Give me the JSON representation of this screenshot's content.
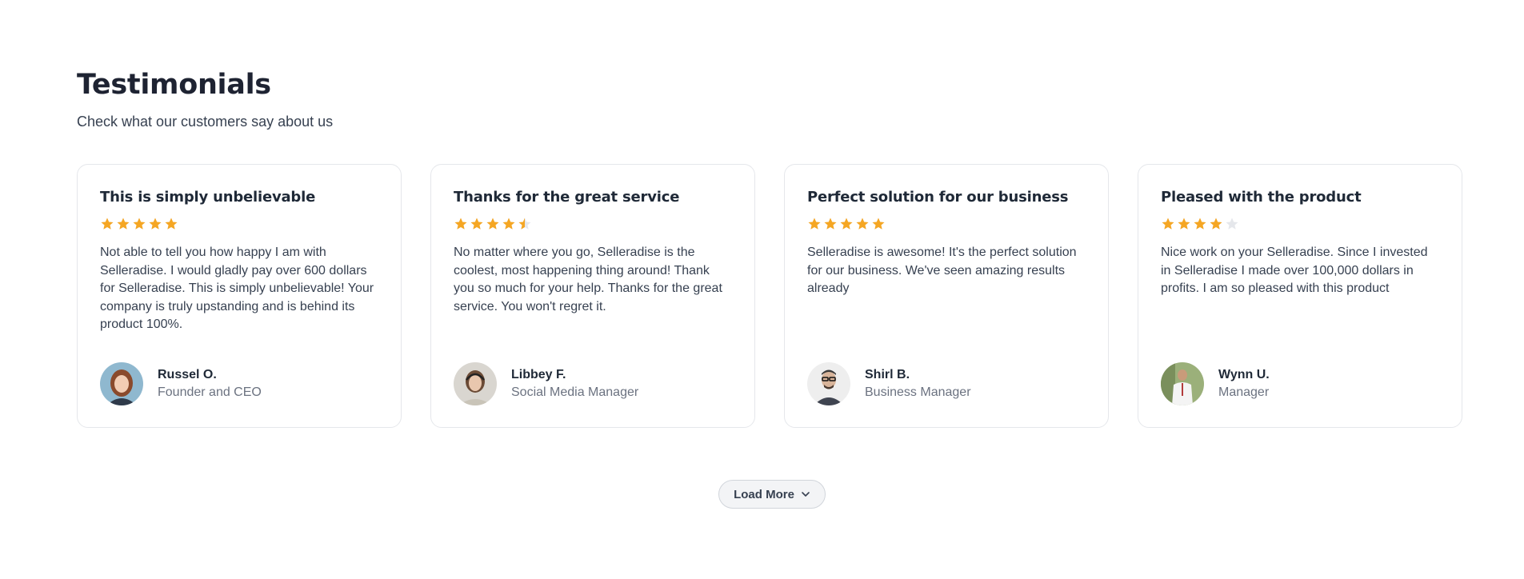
{
  "section": {
    "title": "Testimonials",
    "subtitle": "Check what our customers say about us"
  },
  "colors": {
    "star_filled": "#f5a623",
    "star_empty": "#e5e7eb"
  },
  "testimonials": [
    {
      "title": "This is simply unbelievable",
      "rating": 5,
      "text": "Not able to tell you how happy I am with Selleradise. I would gladly pay over 600 dollars for Selleradise. This is simply unbelievable! Your company is truly upstanding and is behind its product 100%.",
      "name": "Russel O.",
      "role": "Founder and CEO"
    },
    {
      "title": "Thanks for the great service",
      "rating": 4.5,
      "text": "No matter where you go, Selleradise is the coolest, most happening thing around! Thank you so much for your help. Thanks for the great service. You won't regret it.",
      "name": "Libbey F.",
      "role": "Social Media Manager"
    },
    {
      "title": "Perfect solution for our business",
      "rating": 5,
      "text": "Selleradise is awesome! It's the perfect solution for our business. We've seen amazing results already",
      "name": "Shirl B.",
      "role": "Business Manager"
    },
    {
      "title": "Pleased with the product",
      "rating": 4,
      "text": "Nice work on your Selleradise. Since I invested in Selleradise I made over 100,000 dollars in profits. I am so pleased with this product",
      "name": "Wynn U.",
      "role": "Manager"
    }
  ],
  "load_more": {
    "label": "Load More",
    "icon": "chevron-down-icon"
  }
}
